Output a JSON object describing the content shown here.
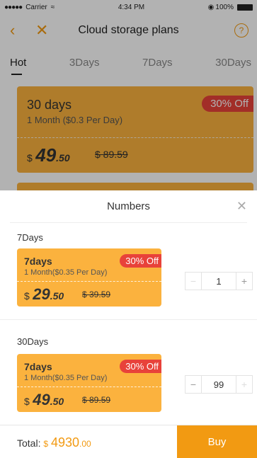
{
  "status_bar": {
    "carrier": "Carrier",
    "time": "4:34 PM",
    "battery": "100%"
  },
  "nav": {
    "title": "Cloud storage plans",
    "back_icon": "chevron-left-icon",
    "close_icon": "close-icon",
    "help_icon": "help-icon"
  },
  "tabs": [
    {
      "label": "Hot",
      "active": true
    },
    {
      "label": "3Days",
      "active": false
    },
    {
      "label": "7Days",
      "active": false
    },
    {
      "label": "30Days",
      "active": false
    }
  ],
  "plan_card": {
    "name": "30 days",
    "desc": "1 Month ($0.3 Per Day)",
    "badge": "30% Off",
    "currency": "$",
    "price_int": "49",
    "price_cents": ".50",
    "old_price": "$ 89.59"
  },
  "sheet": {
    "title": "Numbers",
    "items": [
      {
        "section": "7Days",
        "name": "7days",
        "desc": "1 Month($0.35 Per Day)",
        "badge": "30% Off",
        "currency": "$",
        "price_int": "29",
        "price_cents": ".50",
        "old_price": "$ 39.59",
        "qty": "1",
        "minus": "−",
        "plus": "+"
      },
      {
        "section": "30Days",
        "name": "7days",
        "desc": "1 Month($0.35 Per Day)",
        "badge": "30% Off",
        "currency": "$",
        "price_int": "49",
        "price_cents": ".50",
        "old_price": "$ 89.59",
        "qty": "99",
        "minus": "−",
        "plus": "+"
      }
    ]
  },
  "footer": {
    "total_label": "Total:",
    "currency": "$",
    "total_int": "4930",
    "total_cents": ".00",
    "buy_label": "Buy"
  },
  "colors": {
    "accent": "#f29a12",
    "card": "#fbb23e",
    "badge": "#e8423a"
  }
}
